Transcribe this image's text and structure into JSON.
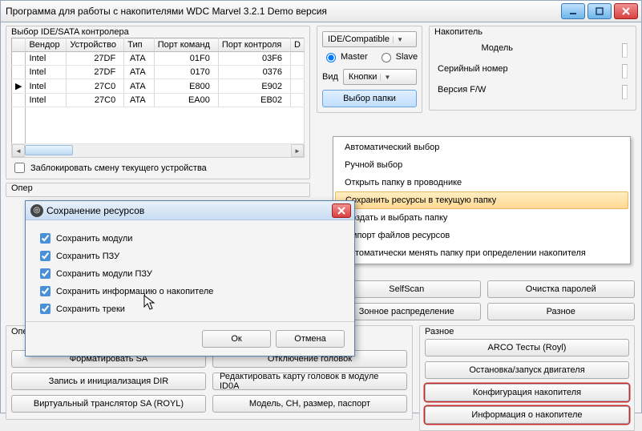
{
  "window": {
    "title": "Программа для работы с накопителями WDC Marvel 3.2.1 Demo версия"
  },
  "leftbox": {
    "title": "Выбор IDE/SATA контролера",
    "cols": [
      "Вендор",
      "Устройство",
      "Тип",
      "Порт команд",
      "Порт контроля",
      "D"
    ],
    "rows": [
      {
        "mark": "",
        "v": [
          "Intel",
          "27DF",
          "ATA",
          "01F0",
          "03F6"
        ]
      },
      {
        "mark": "",
        "v": [
          "Intel",
          "27DF",
          "ATA",
          "0170",
          "0376"
        ]
      },
      {
        "mark": "▶",
        "v": [
          "Intel",
          "27C0",
          "ATA",
          "E800",
          "E902"
        ]
      },
      {
        "mark": "",
        "v": [
          "Intel",
          "27C0",
          "ATA",
          "EA00",
          "EB02"
        ]
      }
    ],
    "lock_label": "Заблокировать смену текущего устройства",
    "oper_title": "Опер"
  },
  "mode": {
    "compat": "IDE/Compatible",
    "master": "Master",
    "slave": "Slave",
    "vid_lbl": "Вид",
    "vid_sel": "Кнопки",
    "folder_btn": "Выбор папки"
  },
  "drive": {
    "title": "Накопитель",
    "f1": "Модель",
    "f2": "Серийный номер",
    "f3": "Версия F/W"
  },
  "menu": {
    "m1": "Автоматический выбор",
    "m2": "Ручной выбор",
    "m3": "Открыть папку в проводнике",
    "m4": "Сохранить ресурсы в текущую папку",
    "m5": "Создать и выбрать папку",
    "m6": "Импорт файлов ресурсов",
    "m7": "Автоматически менять папку при определении накопителя"
  },
  "midbtns": {
    "b1": "SelfScan",
    "b2": "Очистка паролей",
    "b3": "Зонное распределение",
    "b4": "Разное"
  },
  "lowerleft": {
    "title": "Опер",
    "b1": "Форматировать SA",
    "b2": "Отключение головок",
    "b3": "Запись и инициализация DIR",
    "b4": "Редактировать карту головок в модуле ID0A",
    "b5": "Виртуальный транслятор SA (ROYL)",
    "b6": "Модель, CH, размер, паспорт"
  },
  "misc": {
    "title": "Разное",
    "b1": "ARCO Тесты (Royl)",
    "b2": "Остановка/запуск двигателя",
    "b3": "Конфигурация накопителя",
    "b4": "Информация о накопителе"
  },
  "modal": {
    "title": "Сохранение ресурсов",
    "c1": "Сохранить модули",
    "c2": "Сохранить ПЗУ",
    "c3": "Сохранить модули ПЗУ",
    "c4": "Сохранить информацию о накопителе",
    "c5": "Сохранить треки",
    "ok": "Ок",
    "cancel": "Отмена"
  }
}
